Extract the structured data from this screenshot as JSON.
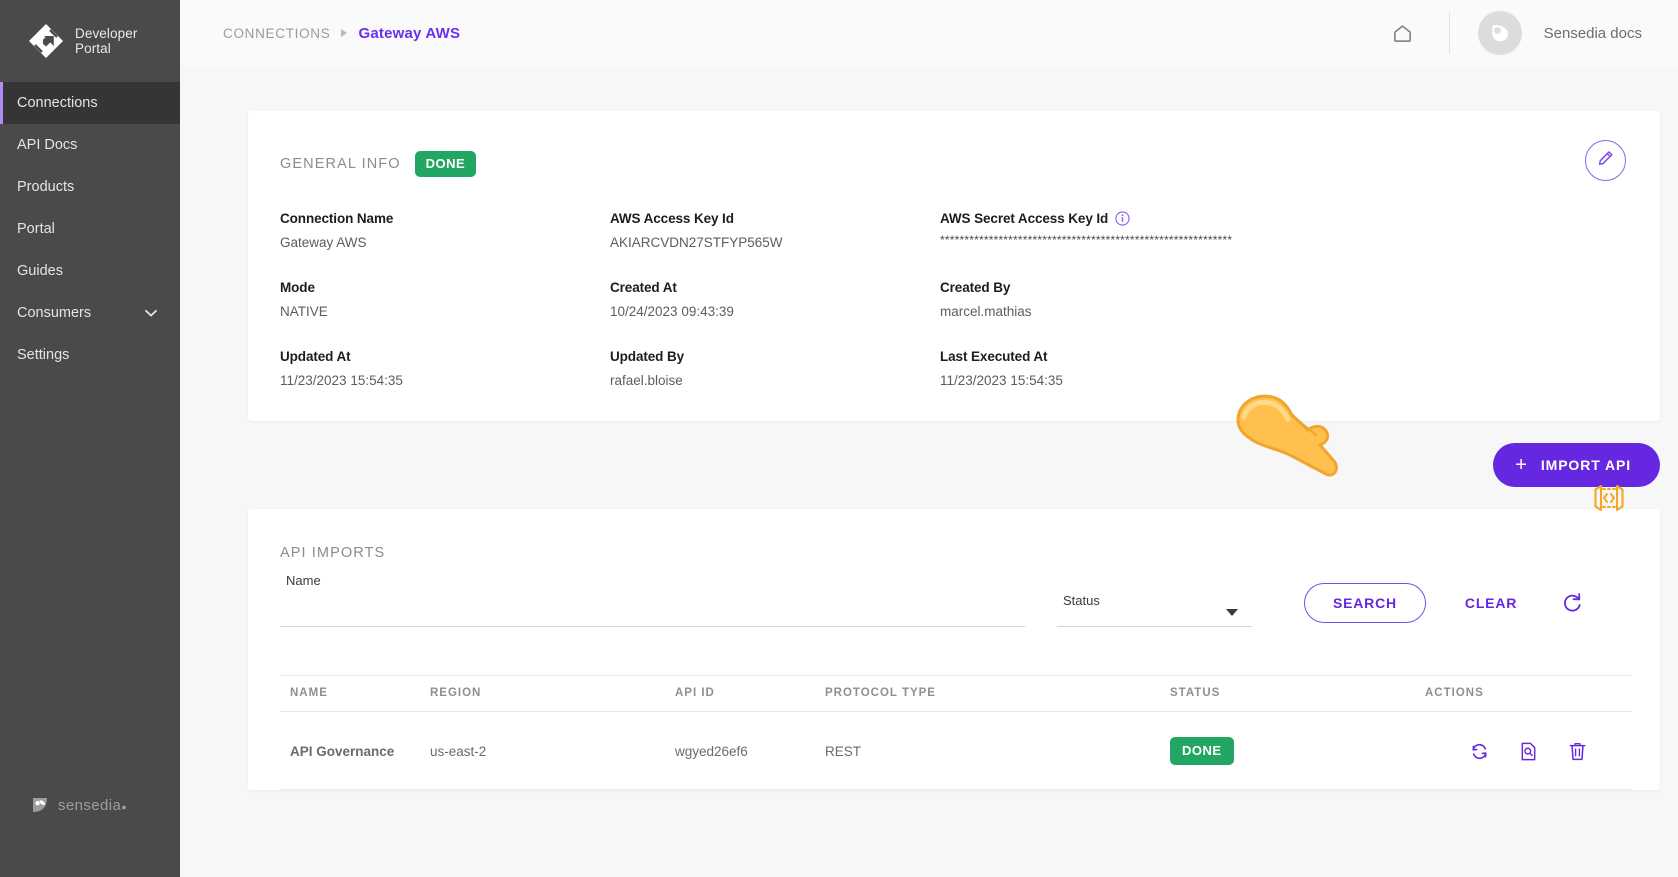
{
  "sidebar": {
    "logo": {
      "icon": "developer-portal-logo-icon",
      "line1": "Developer",
      "line2": "Portal"
    },
    "items": [
      {
        "label": "Connections",
        "active": true
      },
      {
        "label": "API Docs",
        "active": false
      },
      {
        "label": "Products",
        "active": false
      },
      {
        "label": "Portal",
        "active": false
      },
      {
        "label": "Guides",
        "active": false
      },
      {
        "label": "Consumers",
        "active": false,
        "expandable": true
      },
      {
        "label": "Settings",
        "active": false
      }
    ],
    "footer": {
      "brand": "sensedia",
      "icon": "sensedia-logo-icon"
    }
  },
  "topbar": {
    "breadcrumb_root": "CONNECTIONS",
    "breadcrumb_current": "Gateway AWS",
    "home_icon": "home-icon",
    "avatar_icon": "user-avatar-icon",
    "user_name": "Sensedia docs"
  },
  "general_info": {
    "title": "GENERAL INFO",
    "status_badge": "DONE",
    "edit_icon": "pencil-edit-icon",
    "api_code_icon": "api-code-icon",
    "fields": [
      {
        "label": "Connection Name",
        "value": "Gateway AWS",
        "info": false
      },
      {
        "label": "AWS Access Key Id",
        "value": "AKIARCVDN27STFYP565W",
        "info": false
      },
      {
        "label": "AWS Secret Access Key Id",
        "value": "************************************************************",
        "info": true,
        "info_icon": "info-circle-icon",
        "masked": true
      },
      {
        "label": "Mode",
        "value": "NATIVE",
        "info": false
      },
      {
        "label": "Created At",
        "value": "10/24/2023 09:43:39",
        "info": false
      },
      {
        "label": "Created By",
        "value": "marcel.mathias",
        "info": false
      },
      {
        "label": "Updated At",
        "value": "11/23/2023 15:54:35",
        "info": false
      },
      {
        "label": "Updated By",
        "value": "rafael.bloise",
        "info": false
      },
      {
        "label": "Last Executed At",
        "value": "11/23/2023 15:54:35",
        "info": false
      }
    ]
  },
  "import_button": {
    "label": "IMPORT API",
    "plus": "+",
    "icon": "plus-icon"
  },
  "api_imports": {
    "title": "API IMPORTS",
    "filters": {
      "name_label": "Name",
      "name_value": "",
      "name_placeholder": "",
      "status_label": "Status",
      "status_value": "",
      "status_caret_icon": "chevron-down-icon",
      "search_label": "SEARCH",
      "clear_label": "CLEAR",
      "reload_icon": "refresh-icon"
    },
    "columns": [
      "NAME",
      "REGION",
      "API ID",
      "PROTOCOL TYPE",
      "STATUS",
      "ACTIONS"
    ],
    "rows": [
      {
        "name": "API Governance",
        "region": "us-east-2",
        "api_id": "wgyed26ef6",
        "protocol_type": "REST",
        "status": "DONE",
        "actions": [
          "sync-icon",
          "document-search-icon",
          "delete-icon"
        ]
      }
    ]
  },
  "cursor": {
    "icon": "pointing-hand-cursor"
  },
  "colors": {
    "accent_purple": "#6528e0",
    "status_green": "#21a763",
    "sidebar_bg": "#4a4a4a",
    "sidebar_active": "#353535",
    "page_bg": "#f7f7f8",
    "cursor_orange": "#ffc04d"
  }
}
